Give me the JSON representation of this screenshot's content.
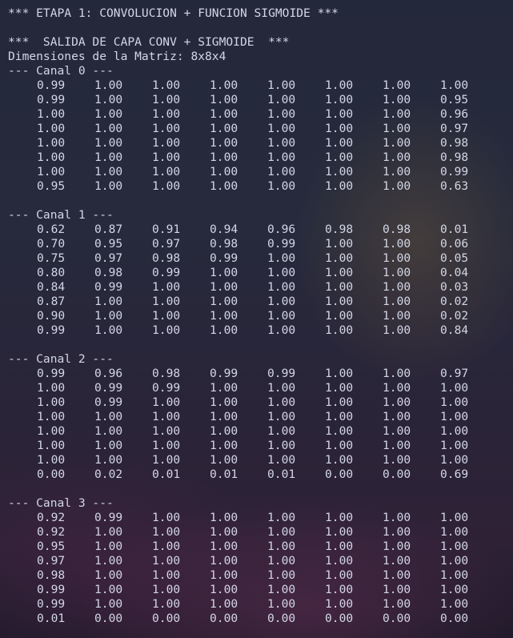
{
  "terminal": {
    "stage_header": "*** ETAPA 1: CONVOLUCION + FUNCION SIGMOIDE ***",
    "output_header": "***  SALIDA DE CAPA CONV + SIGMOIDE  ***",
    "dimensions": "Dimensiones de la Matriz: 8x8x4",
    "channels": [
      {
        "label": "--- Canal 0 ---",
        "rows": [
          [
            "0.99",
            "1.00",
            "1.00",
            "1.00",
            "1.00",
            "1.00",
            "1.00",
            "1.00"
          ],
          [
            "0.99",
            "1.00",
            "1.00",
            "1.00",
            "1.00",
            "1.00",
            "1.00",
            "0.95"
          ],
          [
            "1.00",
            "1.00",
            "1.00",
            "1.00",
            "1.00",
            "1.00",
            "1.00",
            "0.96"
          ],
          [
            "1.00",
            "1.00",
            "1.00",
            "1.00",
            "1.00",
            "1.00",
            "1.00",
            "0.97"
          ],
          [
            "1.00",
            "1.00",
            "1.00",
            "1.00",
            "1.00",
            "1.00",
            "1.00",
            "0.98"
          ],
          [
            "1.00",
            "1.00",
            "1.00",
            "1.00",
            "1.00",
            "1.00",
            "1.00",
            "0.98"
          ],
          [
            "1.00",
            "1.00",
            "1.00",
            "1.00",
            "1.00",
            "1.00",
            "1.00",
            "0.99"
          ],
          [
            "0.95",
            "1.00",
            "1.00",
            "1.00",
            "1.00",
            "1.00",
            "1.00",
            "0.63"
          ]
        ]
      },
      {
        "label": "--- Canal 1 ---",
        "rows": [
          [
            "0.62",
            "0.87",
            "0.91",
            "0.94",
            "0.96",
            "0.98",
            "0.98",
            "0.01"
          ],
          [
            "0.70",
            "0.95",
            "0.97",
            "0.98",
            "0.99",
            "1.00",
            "1.00",
            "0.06"
          ],
          [
            "0.75",
            "0.97",
            "0.98",
            "0.99",
            "1.00",
            "1.00",
            "1.00",
            "0.05"
          ],
          [
            "0.80",
            "0.98",
            "0.99",
            "1.00",
            "1.00",
            "1.00",
            "1.00",
            "0.04"
          ],
          [
            "0.84",
            "0.99",
            "1.00",
            "1.00",
            "1.00",
            "1.00",
            "1.00",
            "0.03"
          ],
          [
            "0.87",
            "1.00",
            "1.00",
            "1.00",
            "1.00",
            "1.00",
            "1.00",
            "0.02"
          ],
          [
            "0.90",
            "1.00",
            "1.00",
            "1.00",
            "1.00",
            "1.00",
            "1.00",
            "0.02"
          ],
          [
            "0.99",
            "1.00",
            "1.00",
            "1.00",
            "1.00",
            "1.00",
            "1.00",
            "0.84"
          ]
        ]
      },
      {
        "label": "--- Canal 2 ---",
        "rows": [
          [
            "0.99",
            "0.96",
            "0.98",
            "0.99",
            "0.99",
            "1.00",
            "1.00",
            "0.97"
          ],
          [
            "1.00",
            "0.99",
            "0.99",
            "1.00",
            "1.00",
            "1.00",
            "1.00",
            "1.00"
          ],
          [
            "1.00",
            "0.99",
            "1.00",
            "1.00",
            "1.00",
            "1.00",
            "1.00",
            "1.00"
          ],
          [
            "1.00",
            "1.00",
            "1.00",
            "1.00",
            "1.00",
            "1.00",
            "1.00",
            "1.00"
          ],
          [
            "1.00",
            "1.00",
            "1.00",
            "1.00",
            "1.00",
            "1.00",
            "1.00",
            "1.00"
          ],
          [
            "1.00",
            "1.00",
            "1.00",
            "1.00",
            "1.00",
            "1.00",
            "1.00",
            "1.00"
          ],
          [
            "1.00",
            "1.00",
            "1.00",
            "1.00",
            "1.00",
            "1.00",
            "1.00",
            "1.00"
          ],
          [
            "0.00",
            "0.02",
            "0.01",
            "0.01",
            "0.01",
            "0.00",
            "0.00",
            "0.69"
          ]
        ]
      },
      {
        "label": "--- Canal 3 ---",
        "rows": [
          [
            "0.92",
            "0.99",
            "1.00",
            "1.00",
            "1.00",
            "1.00",
            "1.00",
            "1.00"
          ],
          [
            "0.92",
            "1.00",
            "1.00",
            "1.00",
            "1.00",
            "1.00",
            "1.00",
            "1.00"
          ],
          [
            "0.95",
            "1.00",
            "1.00",
            "1.00",
            "1.00",
            "1.00",
            "1.00",
            "1.00"
          ],
          [
            "0.97",
            "1.00",
            "1.00",
            "1.00",
            "1.00",
            "1.00",
            "1.00",
            "1.00"
          ],
          [
            "0.98",
            "1.00",
            "1.00",
            "1.00",
            "1.00",
            "1.00",
            "1.00",
            "1.00"
          ],
          [
            "0.99",
            "1.00",
            "1.00",
            "1.00",
            "1.00",
            "1.00",
            "1.00",
            "1.00"
          ],
          [
            "0.99",
            "1.00",
            "1.00",
            "1.00",
            "1.00",
            "1.00",
            "1.00",
            "1.00"
          ],
          [
            "0.01",
            "0.00",
            "0.00",
            "0.00",
            "0.00",
            "0.00",
            "0.00",
            "0.00"
          ]
        ]
      }
    ]
  },
  "colors": {
    "text": "#d3d6e6",
    "background": "#262a3c"
  }
}
